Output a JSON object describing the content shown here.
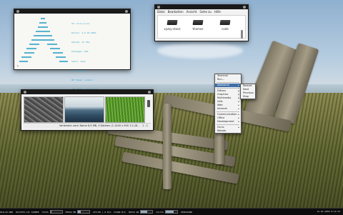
{
  "terminal": {
    "info_lines": [
      "OS: Arch Linux",
      "Kernel: 2.6.28-ARCH",
      "Uptime: 1h 33m",
      "Packages: 683",
      "Shell: bash",
      "WM: Awesome",
      "WM Theme: zenburn",
      "GTK Theme: Clearlooks",
      "Font: DejaVu Sans",
      "CPU: Intel Core2",
      "RAM: 512 / 2011 MB"
    ],
    "prompt": "$"
  },
  "file_manager": {
    "menu": [
      "Datei",
      "Bearbeiten",
      "Ansicht",
      "Gehe zu",
      "Hilfe"
    ],
    "folders": [
      "xyzzy-stock",
      "themes",
      "code"
    ]
  },
  "image_viewer": {
    "status_text": "Verbinden nach Name  6,9 MB, 4 Dateien (1.1440 x 900 1:2,18...",
    "page": "1 : 1"
  },
  "context_menu": {
    "items": [
      {
        "label": "Terminal",
        "submenu": false
      },
      {
        "label": "Run...",
        "submenu": false
      },
      {
        "sep": true
      },
      {
        "label": "Awesome",
        "submenu": true,
        "selected": true
      },
      {
        "sep": true
      },
      {
        "label": "Editors",
        "submenu": true
      },
      {
        "label": "Graphics",
        "submenu": true
      },
      {
        "label": "Multimedia",
        "submenu": true
      },
      {
        "label": "Utils",
        "submenu": true
      },
      {
        "label": "Web",
        "submenu": true
      },
      {
        "label": "Internet",
        "submenu": true
      },
      {
        "sep": true
      },
      {
        "label": "Communication",
        "submenu": true
      },
      {
        "label": "Office",
        "submenu": true
      },
      {
        "label": "Development",
        "submenu": true
      },
      {
        "sep": true
      },
      {
        "label": "Go to",
        "submenu": true
      },
      {
        "label": "Rebate",
        "submenu": false
      }
    ],
    "submenu_items": [
      "Restart",
      "Next",
      "Previous",
      "Stop"
    ]
  },
  "statusbar": {
    "segments": [
      {
        "label": "MAIL",
        "value": "22 NEW"
      },
      {
        "label": "WEATHER",
        "value": "-11C SCHNEE"
      },
      {
        "label": "CPU",
        "value": "3%",
        "level": 0.03
      },
      {
        "label": "MEM",
        "value": "22 MB",
        "level": 0.22
      },
      {
        "label": "UP",
        "value": "3:00 | 0 B/S"
      },
      {
        "label": "DOWN",
        "value": "0 B/S"
      },
      {
        "label": "HDD",
        "value": "54 GB",
        "level": 0.54
      },
      {
        "label": "VOL",
        "value": "71%",
        "level": 0.71
      },
      {
        "label": "MPD",
        "value": "PAUSED"
      }
    ],
    "clock": "12.02.2009 8:12:15"
  }
}
